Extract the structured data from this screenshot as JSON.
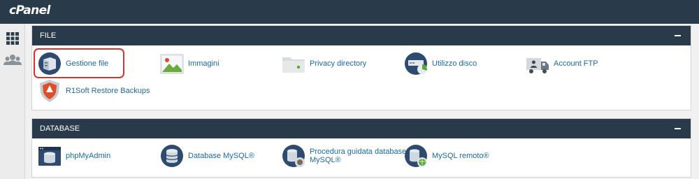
{
  "app": {
    "logo": "cPanel"
  },
  "sidebar": {
    "items": [
      {
        "icon": "apps-grid-icon"
      },
      {
        "icon": "users-icon"
      }
    ]
  },
  "sections": {
    "file": {
      "title": "FILE",
      "items": [
        {
          "label": "Gestione file",
          "icon": "file-manager-icon",
          "highlighted": true
        },
        {
          "label": "Immagini",
          "icon": "images-icon"
        },
        {
          "label": "Privacy directory",
          "icon": "directory-privacy-icon"
        },
        {
          "label": "Utilizzo disco",
          "icon": "disk-usage-icon"
        },
        {
          "label": "Account FTP",
          "icon": "ftp-accounts-icon"
        },
        {
          "label": "R1Soft Restore Backups",
          "icon": "r1soft-shield-icon"
        }
      ]
    },
    "database": {
      "title": "DATABASE",
      "items": [
        {
          "label": "phpMyAdmin",
          "icon": "phpmyadmin-icon"
        },
        {
          "label": "Database MySQL®",
          "icon": "mysql-database-icon"
        },
        {
          "label": "Procedura guidata database",
          "label2": "MySQL®",
          "icon": "mysql-wizard-icon"
        },
        {
          "label": "MySQL remoto®",
          "icon": "remote-mysql-icon"
        }
      ]
    }
  },
  "colors": {
    "header": "#293a4a",
    "link": "#1b6aa3",
    "highlight_border": "#d9322c"
  }
}
